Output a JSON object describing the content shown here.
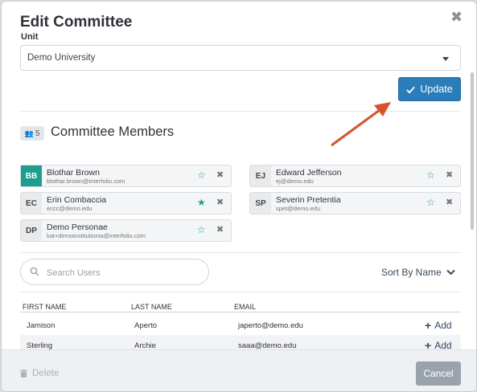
{
  "modal": {
    "title": "Edit Committee"
  },
  "unit": {
    "label": "Unit",
    "value": "Demo University"
  },
  "update_button": {
    "label": "Update"
  },
  "members": {
    "count": "5",
    "title": "Committee Members",
    "list": [
      {
        "initials": "BB",
        "name": "Blothar Brown",
        "email": "blothar.brown@interfolio.com",
        "starred": false
      },
      {
        "initials": "EJ",
        "name": "Edward Jefferson",
        "email": "ej@demo.edu",
        "starred": false
      },
      {
        "initials": "EC",
        "name": "Erin Combaccia",
        "email": "eccc@demo.edu",
        "starred": true
      },
      {
        "initials": "SP",
        "name": "Severin Pretentia",
        "email": "spet@demo.edu",
        "starred": false
      },
      {
        "initials": "DP",
        "name": "Demo Personae",
        "email": "kat+demoinstitutionia@interfolio.com",
        "starred": false
      }
    ]
  },
  "search": {
    "placeholder": "Search Users"
  },
  "sort": {
    "label": "Sort By Name"
  },
  "table": {
    "headers": {
      "first": "FIRST NAME",
      "last": "LAST NAME",
      "email": "EMAIL"
    },
    "rows": [
      {
        "first": "Jamison",
        "last": "Aperto",
        "email": "japerto@demo.edu",
        "action": "Add"
      },
      {
        "first": "Sterling",
        "last": "Archie",
        "email": "saaa@demo.edu",
        "action": "Add"
      }
    ]
  },
  "footer": {
    "delete_label": "Delete",
    "cancel_label": "Cancel"
  },
  "colors": {
    "accent": "#2a7db8",
    "teal": "#1f9e8e",
    "arrow": "#d4542b"
  },
  "icons": {
    "close": "close-icon",
    "check": "check-icon",
    "people": "people-icon",
    "star": "star-icon",
    "remove": "x-icon",
    "search": "search-icon",
    "chevron": "chevron-down-icon",
    "trash": "trash-icon"
  }
}
